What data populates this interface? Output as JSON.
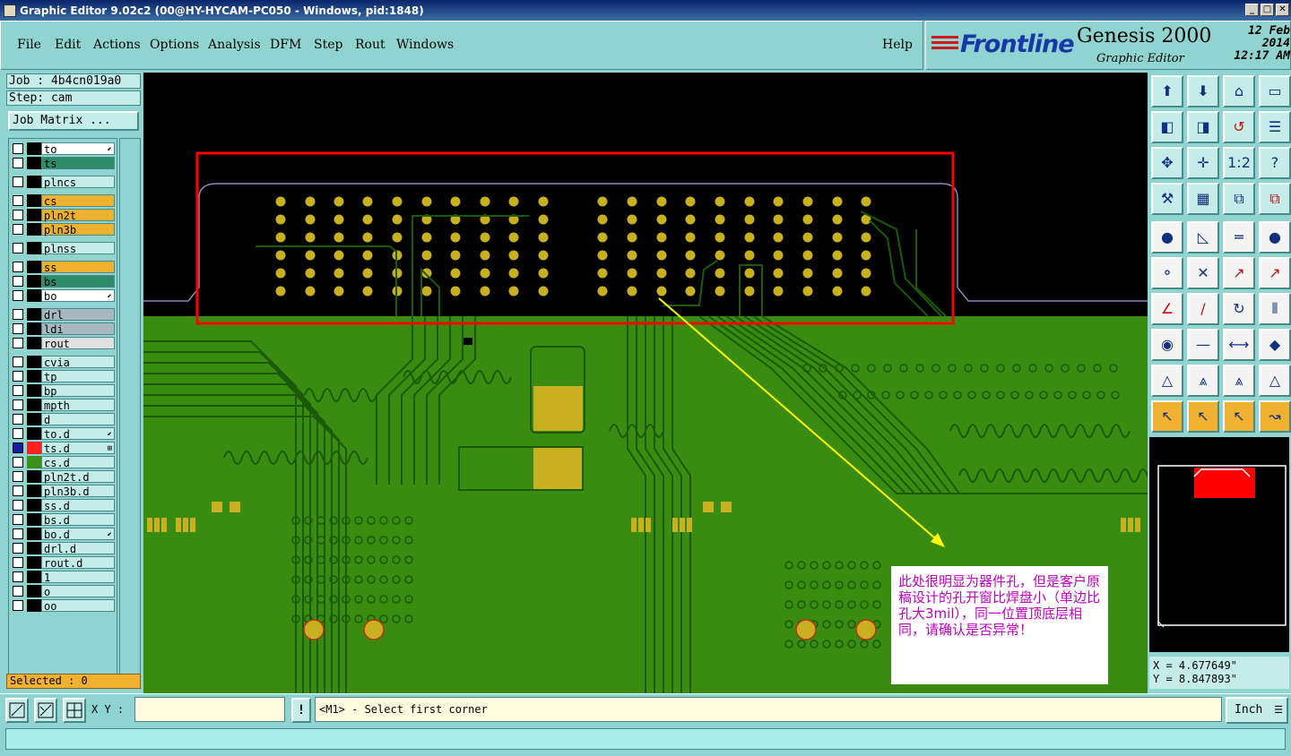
{
  "window": {
    "title": "Graphic Editor 9.02c2 (00@HY-HYCAM-PC050 - Windows, pid:1848)"
  },
  "menu": {
    "file": "File",
    "edit": "Edit",
    "actions": "Actions",
    "options": "Options",
    "analysis": "Analysis",
    "dfm": "DFM",
    "step": "Step",
    "rout": "Rout",
    "windows": "Windows",
    "help": "Help"
  },
  "brand": {
    "logo": "Frontline",
    "product": "Genesis 2000",
    "subtitle": "Graphic Editor",
    "date": "12 Feb 2014",
    "time": "12:17 AM"
  },
  "job": {
    "job_label": "Job : 4b4cn019a0",
    "step_label": "Step: cam",
    "matrix_button": "Job Matrix ..."
  },
  "layers": [
    {
      "name": "to",
      "color": "#ffffff",
      "mark": "⬋"
    },
    {
      "name": "ts",
      "color": "#2e8b6a",
      "mark": ""
    },
    {
      "name": "plncs",
      "color": "#c4ece8",
      "mark": ""
    },
    {
      "name": "cs",
      "color": "#f0b030",
      "mark": ""
    },
    {
      "name": "pln2t",
      "color": "#f0b030",
      "mark": ""
    },
    {
      "name": "pln3b",
      "color": "#f0b030",
      "mark": ""
    },
    {
      "name": "plnss",
      "color": "#c4ece8",
      "mark": ""
    },
    {
      "name": "ss",
      "color": "#f0b030",
      "mark": ""
    },
    {
      "name": "bs",
      "color": "#2e8b6a",
      "mark": ""
    },
    {
      "name": "bo",
      "color": "#ffffff",
      "mark": "⬋"
    },
    {
      "name": "drl",
      "color": "#a8b8c0",
      "mark": ""
    },
    {
      "name": "ldi",
      "color": "#a8b8c0",
      "mark": ""
    },
    {
      "name": "rout",
      "color": "#e0e0e0",
      "mark": ""
    },
    {
      "name": "cvia",
      "color": "#c4ece8",
      "mark": ""
    },
    {
      "name": "tp",
      "color": "#c4ece8",
      "mark": ""
    },
    {
      "name": "bp",
      "color": "#c4ece8",
      "mark": ""
    },
    {
      "name": "mpth",
      "color": "#c4ece8",
      "mark": ""
    },
    {
      "name": "d",
      "color": "#c4ece8",
      "mark": ""
    },
    {
      "name": "to.d",
      "color": "#c4ece8",
      "mark": "⬋"
    },
    {
      "name": "ts.d",
      "color": "#c4ece8",
      "mark": "⊞"
    },
    {
      "name": "cs.d",
      "color": "#c4ece8",
      "mark": ""
    },
    {
      "name": "pln2t.d",
      "color": "#c4ece8",
      "mark": ""
    },
    {
      "name": "pln3b.d",
      "color": "#c4ece8",
      "mark": ""
    },
    {
      "name": "ss.d",
      "color": "#c4ece8",
      "mark": ""
    },
    {
      "name": "bs.d",
      "color": "#c4ece8",
      "mark": ""
    },
    {
      "name": "bo.d",
      "color": "#c4ece8",
      "mark": "⬋"
    },
    {
      "name": "drl.d",
      "color": "#c4ece8",
      "mark": ""
    },
    {
      "name": "rout.d",
      "color": "#c4ece8",
      "mark": ""
    },
    {
      "name": "1",
      "color": "#c4ece8",
      "mark": ""
    },
    {
      "name": "o",
      "color": "#c4ece8",
      "mark": ""
    },
    {
      "name": "oo",
      "color": "#c4ece8",
      "mark": ""
    }
  ],
  "selected": "Selected : 0",
  "coords": {
    "x": "X =  4.677649\"",
    "y": "Y =  8.847893\""
  },
  "status": {
    "xy_label": "X Y :",
    "xy_value": "",
    "message_button": "!",
    "message": "<M1> - Select first corner",
    "units": "Inch"
  },
  "annotation": {
    "text": "此处很明显为器件孔，但是客户原稿设计的孔开窗比焊盘小（单边比孔大3mil），同一位置顶底层相同，请确认是否异常！"
  },
  "colors": {
    "board": "#3a8c10",
    "trace": "#1a5a08",
    "pad": "#c8b020",
    "highlight": "#ff0000",
    "arrow": "#ffff00"
  },
  "tools": [
    "layers-up-icon",
    "layers-down-icon",
    "home-icon",
    "window-icon",
    "pan-left-icon",
    "pan-right-icon",
    "redraw-icon",
    "layout-icon",
    "fit-icon",
    "center-icon",
    "one-to-one-icon",
    "help-icon",
    "measure-icon",
    "grid-icon",
    "snap-icon",
    "snap-red-icon",
    "fill-icon",
    "outline-icon",
    "ruler-icon",
    "dot-icon",
    "net-icon",
    "cross-icon",
    "connect-icon",
    "connect-red-icon",
    "line-icon",
    "line-blue-icon",
    "arc-icon",
    "ff-icon",
    "pad-icon",
    "minus-icon",
    "dim-icon",
    "shapes-icon",
    "triangle-icon",
    "triangle-blue-icon",
    "triangle-blue2-icon",
    "triangle-outline-icon",
    "cursor-icon",
    "cursor-box-icon",
    "cursor-circle-icon",
    "route-icon"
  ]
}
